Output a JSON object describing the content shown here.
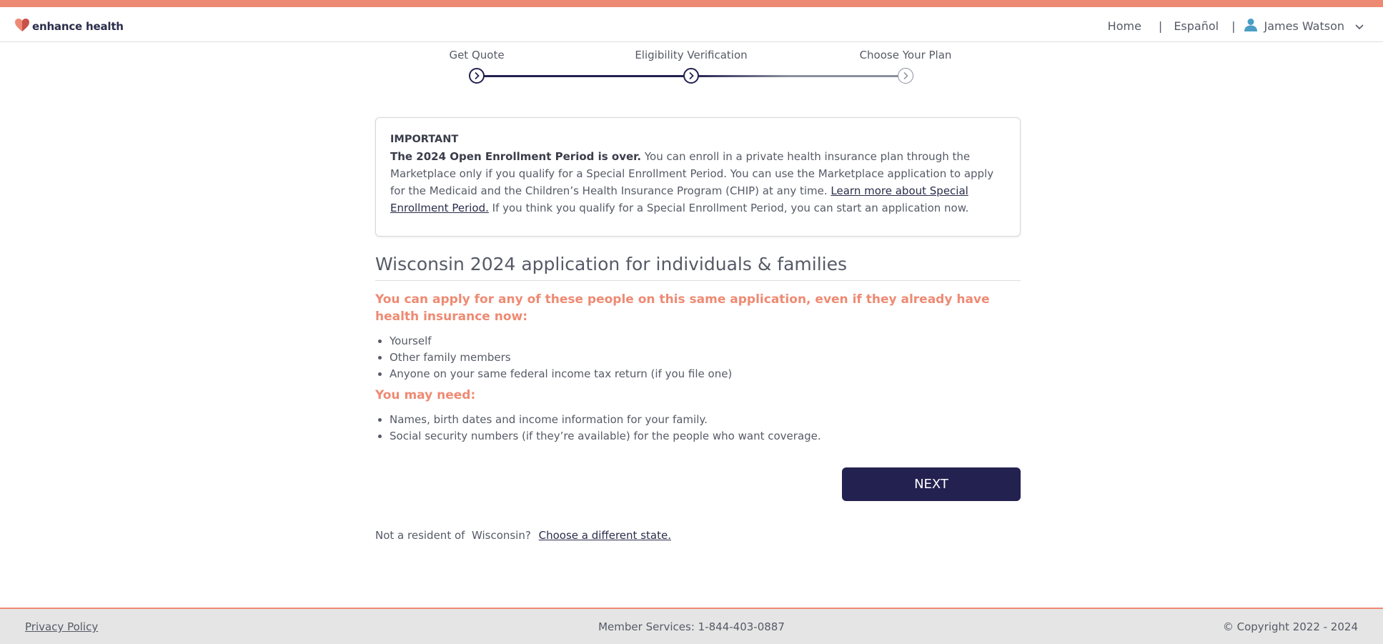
{
  "brand": {
    "name": "enhance health",
    "accent": "#ee8a73",
    "primary": "#232150"
  },
  "nav": {
    "home": "Home",
    "language": "Español",
    "separator": "|",
    "user_name": "James Watson"
  },
  "steps": [
    {
      "label": "Get Quote",
      "state": "complete"
    },
    {
      "label": "Eligibility Verification",
      "state": "current"
    },
    {
      "label": "Choose Your Plan",
      "state": "upcoming"
    }
  ],
  "notice": {
    "heading": "IMPORTANT",
    "bold_lead": "The 2024 Open Enrollment Period is over.",
    "body": " You can enroll in a private health insurance plan through the Marketplace only if you qualify for a Special Enrollment Period. You can use the Marketplace application to apply for the Medicaid and the Children’s Health Insurance Program (CHIP) at any time. ",
    "link": "Learn more about Special Enrollment Period.",
    "tail": " If you think you qualify for a Special Enrollment Period, you can start an application now."
  },
  "main": {
    "title": "Wisconsin 2024 application for individuals & families",
    "apply_heading": "You can apply for any of these people on this same application, even if they already have health insurance now:",
    "apply_items": [
      "Yourself",
      "Other family members",
      "Anyone on your same federal income tax return (if you file one)"
    ],
    "need_heading": "You may need:",
    "need_items": [
      "Names, birth dates and income information for your family.",
      "Social security numbers (if they’re available) for the people who want coverage."
    ],
    "next_button": "NEXT",
    "resident_text": "Not a resident of  Wisconsin?",
    "resident_link": "Choose a different state."
  },
  "footer": {
    "privacy": "Privacy Policy",
    "member_services": "Member Services: 1-844-403-0887",
    "copyright": "© Copyright 2022 - 2024"
  }
}
